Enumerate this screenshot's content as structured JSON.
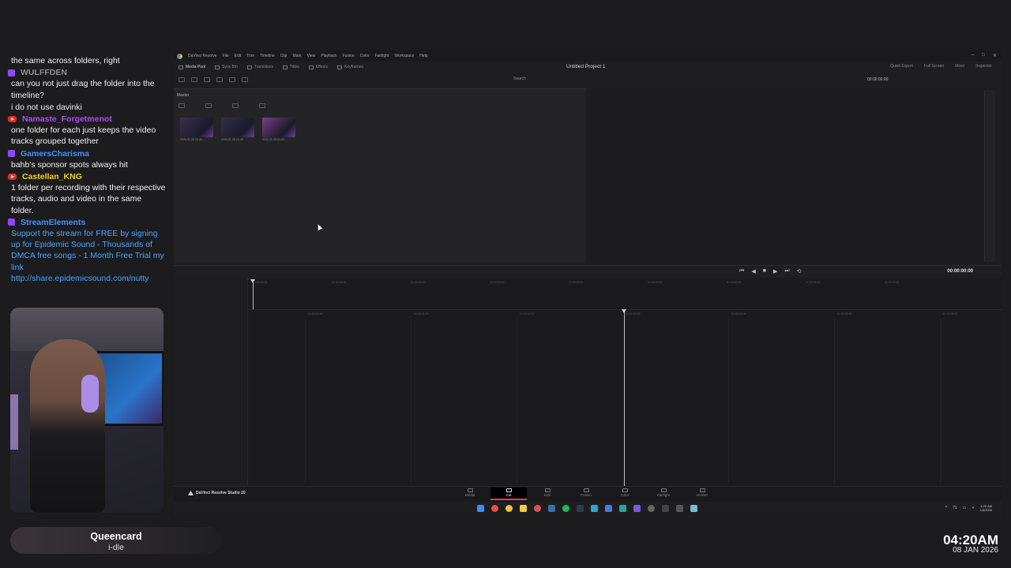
{
  "chat": {
    "messages": [
      {
        "user": "",
        "text": "the same across folders, right",
        "platform": "none",
        "user_color": "#ffffff"
      },
      {
        "user": "WULFFDEN",
        "text": "can you not just drag the folder into the timeline?",
        "platform": "twitch",
        "user_color": "#8f8f8f"
      },
      {
        "user": "",
        "text": "i do not use davinki",
        "platform": "none",
        "user_color": "#ffffff"
      },
      {
        "user": "Namaste_Forgetmenot",
        "text": "one folder for each just keeps the video tracks grouped together",
        "platform": "youtube",
        "user_color": "#b04cf2"
      },
      {
        "user": "GamersCharisma",
        "text": "bahb's sponsor spots always hit",
        "platform": "twitch",
        "user_color": "#4a8cff"
      },
      {
        "user": "Castellan_KNG",
        "text": "1 folder per recording with their respective tracks, audio and video in the same folder.",
        "platform": "youtube",
        "user_color": "#f5d020"
      },
      {
        "user": "StreamElements",
        "text": "Support the stream for FREE by signing up for Epidemic Sound - Thousands of DMCA free songs - 1 Month Free Trial my link",
        "link": "http://share.epidemicsound.com/nutty",
        "platform": "twitch",
        "user_color": "#4a8cff"
      }
    ]
  },
  "now_playing": {
    "title": "Queencard",
    "artist": "i-dle"
  },
  "clock": {
    "time": "04:20AM",
    "date": "08 JAN 2026"
  },
  "app": {
    "menu": [
      "DaVinci Resolve",
      "File",
      "Edit",
      "Trim",
      "Timeline",
      "Clip",
      "Mark",
      "View",
      "Playback",
      "Fusion",
      "Color",
      "Fairlight",
      "Workspace",
      "Help"
    ],
    "toolbar_left": [
      "Media Pool",
      "Sync Bin",
      "Transitions",
      "Titles",
      "Effects",
      "Keyframes"
    ],
    "project_title": "Untitled Project 1",
    "toolbar_right": [
      "Quick Export",
      "Full Screen",
      "Mixer",
      "Inspector"
    ],
    "search_placeholder": "Search",
    "timecode_top": "00:00:00:00",
    "timecode_main": "00:00:00:00",
    "bin_label": "Master",
    "clips": [
      {
        "name": "2026-01-08 03-40...",
        "color": "#3a3050"
      },
      {
        "name": "2026-01-08 03-40...",
        "color": "#33304a"
      },
      {
        "name": "2026-01-08 03-40...",
        "color": "#7a3f88"
      }
    ],
    "brand": "DaVinci Resolve Studio 20",
    "pages": [
      "Media",
      "Cut",
      "Edit",
      "Fusion",
      "Color",
      "Fairlight",
      "Deliver"
    ],
    "active_page": "Cut",
    "ruler_ticks": [
      "01:00:00:00",
      "01:00:05:00",
      "01:00:10:00",
      "01:00:15:00",
      "01:00:20:00",
      "01:00:25:00",
      "01:00:30:00",
      "01:00:35:00",
      "01:00:40:00"
    ],
    "lower_ticks": [
      "01:00:00:00",
      "01:00:01:00",
      "01:00:02:00",
      "01:00:03:00",
      "01:00:04:00",
      "01:00:05:00",
      "01:00:06:00"
    ],
    "tray": {
      "temp": "71",
      "time": "4:20 AM",
      "date": "1/8/2026"
    }
  }
}
